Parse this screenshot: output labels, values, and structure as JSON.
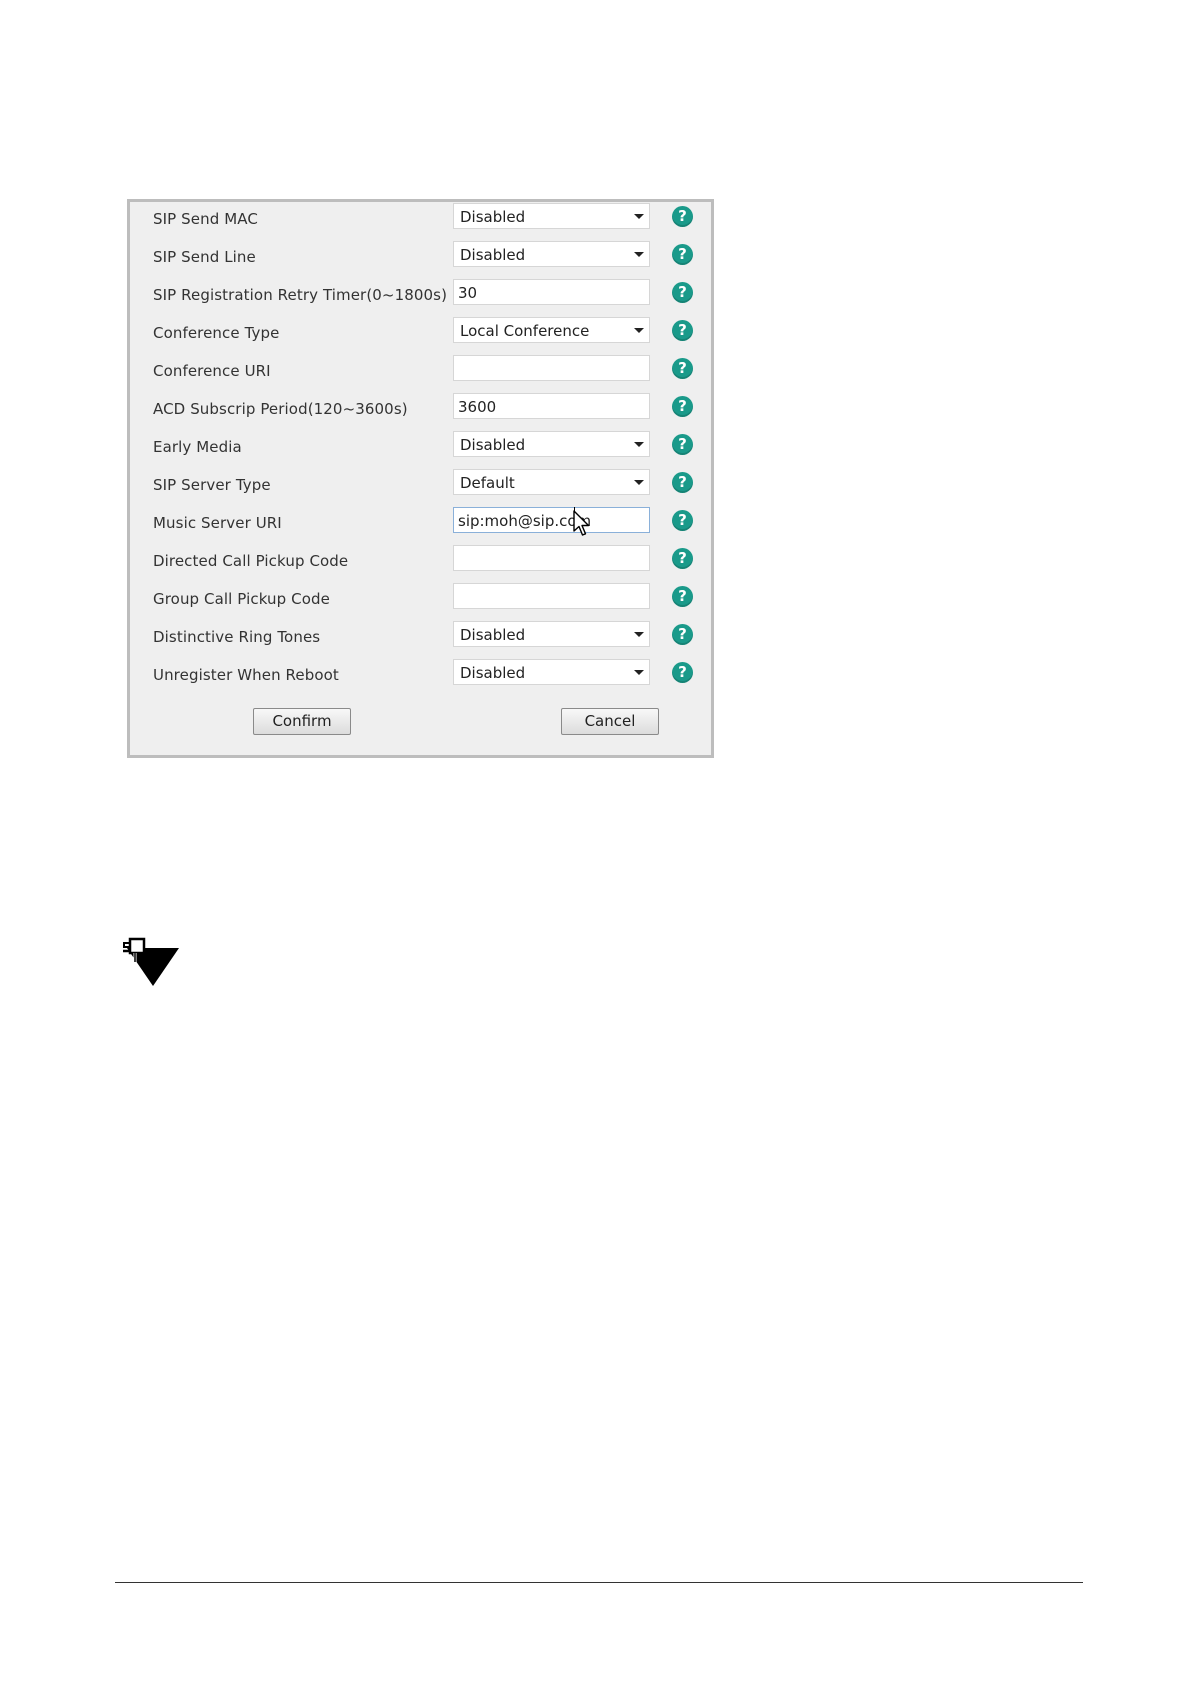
{
  "settings": [
    {
      "label": "SIP Send MAC",
      "type": "select",
      "value": "Disabled"
    },
    {
      "label": "SIP Send Line",
      "type": "select",
      "value": "Disabled"
    },
    {
      "label": "SIP Registration Retry Timer(0~1800s)",
      "type": "input",
      "value": "30"
    },
    {
      "label": "Conference Type",
      "type": "select",
      "value": "Local Conference"
    },
    {
      "label": "Conference URI",
      "type": "input",
      "value": ""
    },
    {
      "label": "ACD Subscrip Period(120~3600s)",
      "type": "input",
      "value": "3600"
    },
    {
      "label": "Early Media",
      "type": "select",
      "value": "Disabled"
    },
    {
      "label": "SIP Server Type",
      "type": "select",
      "value": "Default"
    },
    {
      "label": "Music Server URI",
      "type": "input",
      "value": "sip:moh@sip.com"
    },
    {
      "label": "Directed Call Pickup Code",
      "type": "input",
      "value": ""
    },
    {
      "label": "Group Call Pickup Code",
      "type": "input",
      "value": ""
    },
    {
      "label": "Distinctive Ring Tones",
      "type": "select",
      "value": "Disabled"
    },
    {
      "label": "Unregister When Reboot",
      "type": "select",
      "value": "Disabled"
    }
  ],
  "help_glyph": "?",
  "buttons": {
    "confirm": "Confirm",
    "cancel": "Cancel"
  },
  "colors": {
    "help_icon": "#1a9a8a",
    "panel_bg": "#efefef"
  },
  "icons": {
    "help": "help-question-icon",
    "note": "note-pin-icon",
    "pointer": "mouse-pointer-icon"
  }
}
